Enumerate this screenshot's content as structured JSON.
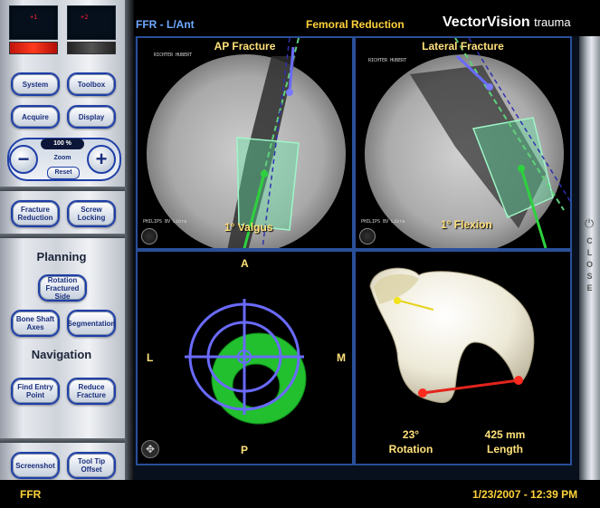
{
  "left_panel": {
    "monitors": [
      "+1",
      "+2"
    ],
    "buttons_top": {
      "system": "System",
      "toolbox": "Toolbox",
      "acquire": "Acquire",
      "display": "Display"
    },
    "zoom": {
      "value": "100 %",
      "label": "Zoom",
      "reset": "Reset",
      "minus": "−",
      "plus": "+"
    },
    "workflow": {
      "fracture_reduction": "Fracture Reduction",
      "screw_locking": "Screw Locking"
    },
    "planning": {
      "title": "Planning",
      "rotation": "Rotation Fractured Side",
      "bone_shaft_axes": "Bone Shaft Axes",
      "segmentation": "Segmentation"
    },
    "navigation": {
      "title": "Navigation",
      "find_entry_point": "Find Entry Point",
      "reduce_fracture": "Reduce Fracture"
    },
    "bottom": {
      "screenshot": "Screenshot",
      "tool_tip_offset": "Tool Tip Offset"
    }
  },
  "header": {
    "mode": "FFR - L/Ant",
    "title": "Femoral Reduction",
    "brand_main": "VectorVision",
    "brand_sub": "trauma"
  },
  "ap_view": {
    "title": "AP Fracture",
    "patient": "RICHTER HUBERT",
    "vendor": "PHILIPS BV Libra",
    "angle": "1° Valgus"
  },
  "lateral_view": {
    "title": "Lateral Fracture",
    "patient": "RICHTER HUBERT",
    "vendor": "PHILIPS BV Libra",
    "angle": "1° Flexion"
  },
  "target_view": {
    "anterior": "A",
    "posterior": "P",
    "lateral": "L",
    "medial": "M"
  },
  "model_view": {
    "rotation_value": "23°",
    "rotation_label": "Rotation",
    "length_value": "425 mm",
    "length_label": "Length"
  },
  "close_strip": {
    "label": "CLOSE"
  },
  "footer": {
    "left": "FFR",
    "datetime": "1/23/2007 - 12:39 PM"
  },
  "colors": {
    "accent_blue": "#1f3fa8",
    "label_yellow": "#ffe17a",
    "footer_yellow": "#ffd23a",
    "guide_green": "#2ecc40",
    "axis_blue": "#5b5bff"
  }
}
